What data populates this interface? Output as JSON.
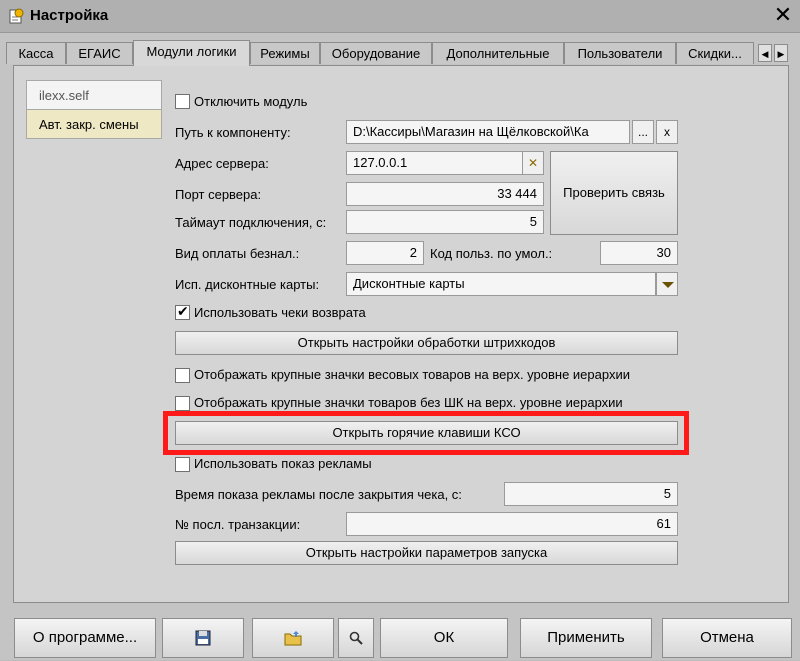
{
  "window": {
    "title": "Настройка",
    "close_symbol": "✕"
  },
  "tabs": [
    {
      "label": "Касса"
    },
    {
      "label": "ЕГАИС"
    },
    {
      "label": "Модули логики"
    },
    {
      "label": "Режимы"
    },
    {
      "label": "Оборудование"
    },
    {
      "label": "Дополнительные"
    },
    {
      "label": "Пользователи"
    },
    {
      "label": "Скидки..."
    }
  ],
  "tab_nav": {
    "prev": "◀",
    "next": "▶"
  },
  "sidebar": [
    {
      "label": "ilexx.self"
    },
    {
      "label": "Авт. закр. смены"
    }
  ],
  "form": {
    "disable_module": {
      "label": "Отключить модуль",
      "checked": false
    },
    "component_path": {
      "label": "Путь к компоненту:",
      "value": "D:\\Кассиры\\Магазин на Щёлковской\\Ка",
      "browse": "...",
      "clear": "x"
    },
    "server_address": {
      "label": "Адрес сервера:",
      "value": "127.0.0.1",
      "clear": "✕"
    },
    "server_port": {
      "label": "Порт сервера:",
      "value": "33 444"
    },
    "check_connection": {
      "label": "Проверить связь"
    },
    "timeout": {
      "label": "Таймаут подключения, с:",
      "value": "5"
    },
    "cashless_type": {
      "label": "Вид оплаты безнал.:",
      "value": "2"
    },
    "default_user_code": {
      "label": "Код польз. по умол.:",
      "value": "30"
    },
    "discount_cards": {
      "label": "Исп. дисконтные карты:",
      "value": "Дисконтные карты"
    },
    "use_return_checks": {
      "label": "Использовать чеки возврата",
      "checked": true
    },
    "barcode_settings_button": "Открыть настройки обработки штрихкодов",
    "large_weight_icons": {
      "label": "Отображать крупные значки весовых товаров на верх. уровне иерархии",
      "checked": false
    },
    "large_icons_no_barcode": {
      "label": "Отображать крупные значки товаров без ШК на верх. уровне иерархии",
      "checked": false
    },
    "hotkeys_button": "Открыть горячие клавиши КСО",
    "use_ads": {
      "label": "Использовать показ рекламы",
      "checked": false
    },
    "ad_time": {
      "label": "Время показа рекламы после закрытия чека, с:",
      "value": "5"
    },
    "last_transaction": {
      "label": "№ посл. транзакции:",
      "value": "61"
    },
    "launch_params_button": "Открыть настройки параметров запуска"
  },
  "bottom": {
    "about": "О программе...",
    "save_icon": "floppy-disk-icon",
    "open_icon": "folder-icon",
    "search_icon": "magnifier-icon",
    "ok": "ОК",
    "apply": "Применить",
    "cancel": "Отмена"
  },
  "colors": {
    "highlight": "#ff1a1a",
    "dropdown_arrow": "#6a5200"
  }
}
